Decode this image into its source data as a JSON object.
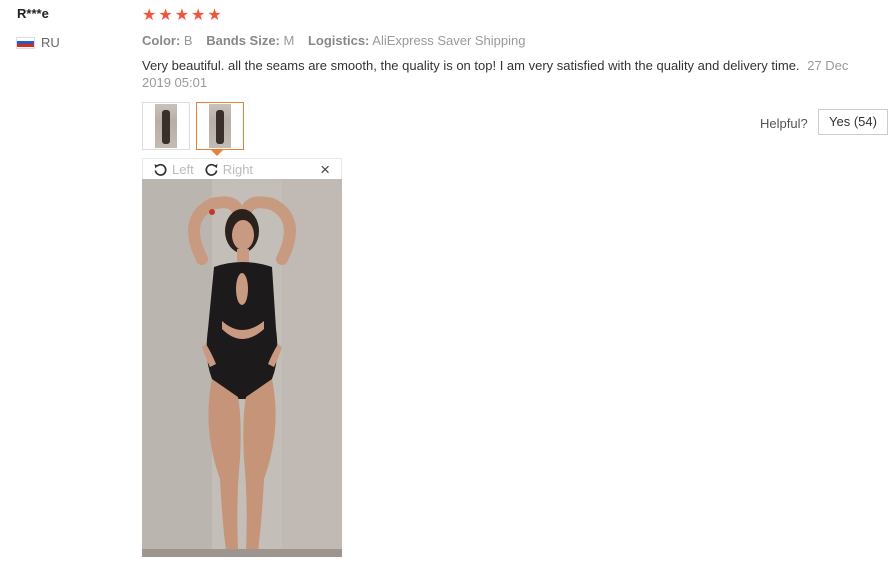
{
  "reviewer": {
    "name": "R***e",
    "country_code": "RU",
    "flag_colors": [
      "#ffffff",
      "#2b59c3",
      "#d52b1e"
    ]
  },
  "rating": {
    "stars": 5,
    "max": 5,
    "color": "#f0553e"
  },
  "attributes": [
    {
      "label": "Color:",
      "value": "B"
    },
    {
      "label": "Bands Size:",
      "value": "M"
    },
    {
      "label": "Logistics:",
      "value": "AliExpress Saver Shipping"
    }
  ],
  "review": {
    "text": "Very beautiful. all the seams are smooth, the quality is on top! I am very satisfied with the quality and delivery time.",
    "date": "27 Dec 2019 05:01"
  },
  "helpful": {
    "label": "Helpful?",
    "button": "Yes (54)"
  },
  "viewer": {
    "rotate_left": "Left",
    "rotate_right": "Right",
    "close": "×"
  },
  "colors": {
    "accent": "#e6813a"
  }
}
